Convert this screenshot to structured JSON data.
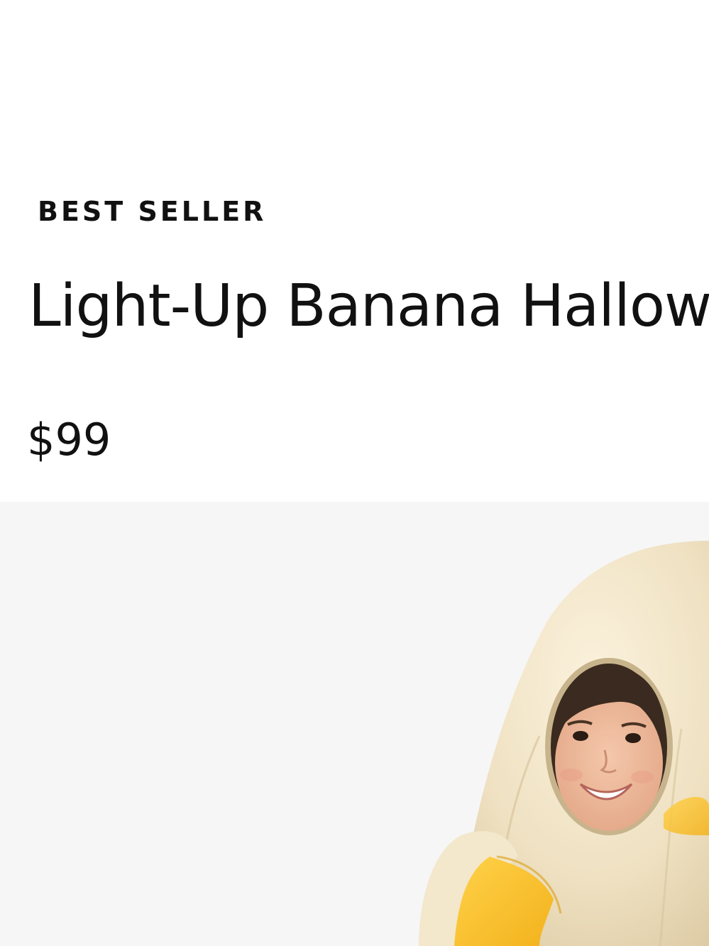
{
  "product": {
    "badge": "BEST SELLER",
    "title": "Light-Up Banana Hallow",
    "price": "$99"
  },
  "image": {
    "subject": "product-photo",
    "background_color": "#f6f6f6"
  }
}
